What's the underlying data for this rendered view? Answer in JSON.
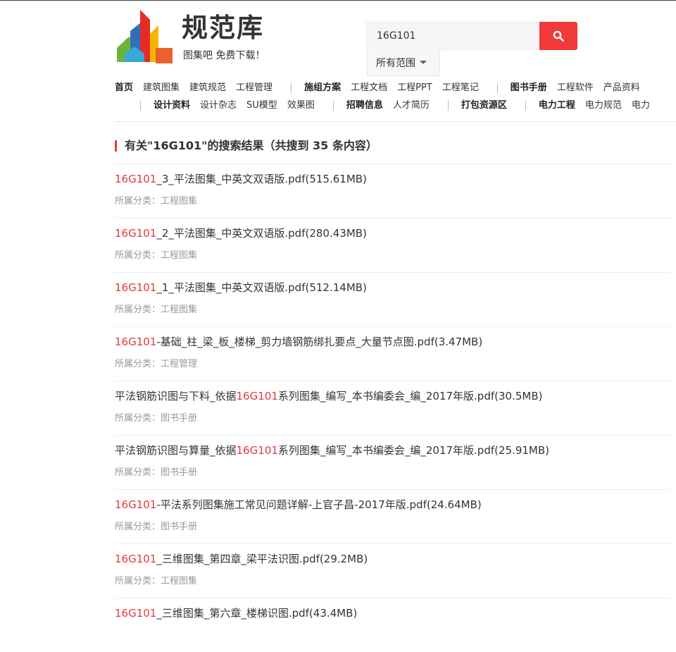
{
  "logo": {
    "name": "规范库",
    "tagline": "图集吧  免费下载！"
  },
  "search": {
    "query": "16G101",
    "scope_label": "所有范围"
  },
  "nav": {
    "row1": [
      {
        "label": "首页",
        "bold": true
      },
      {
        "label": "建筑图集"
      },
      {
        "label": "建筑规范"
      },
      {
        "label": "工程管理"
      },
      {
        "sep": true
      },
      {
        "label": "施组方案",
        "bold": true
      },
      {
        "label": "工程文档"
      },
      {
        "label": "工程PPT"
      },
      {
        "label": "工程笔记"
      },
      {
        "sep": true
      },
      {
        "label": "图书手册",
        "bold": true
      },
      {
        "label": "工程软件"
      },
      {
        "label": "产品资料"
      }
    ],
    "row2": [
      {
        "sep": true
      },
      {
        "label": "设计资料",
        "bold": true
      },
      {
        "label": "设计杂志"
      },
      {
        "label": "SU模型"
      },
      {
        "label": "效果图"
      },
      {
        "sep": true
      },
      {
        "label": "招聘信息",
        "bold": true
      },
      {
        "label": "人才简历"
      },
      {
        "sep": true
      },
      {
        "label": "打包资源区",
        "bold": true
      },
      {
        "sep": true
      },
      {
        "label": "电力工程",
        "bold": true
      },
      {
        "label": "电力规范"
      },
      {
        "label": "电力"
      }
    ]
  },
  "results_heading": "有关\"16G101\"的搜索结果（共搜到 35 条内容）",
  "category_prefix": "所属分类：",
  "results": [
    {
      "pre": "",
      "hl": "16G101",
      "post": "_3_平法图集_中英文双语版.pdf(515.61MB)",
      "category": "工程图集"
    },
    {
      "pre": "",
      "hl": "16G101",
      "post": "_2_平法图集_中英文双语版.pdf(280.43MB)",
      "category": "工程图集"
    },
    {
      "pre": "",
      "hl": "16G101",
      "post": "_1_平法图集_中英文双语版.pdf(512.14MB)",
      "category": "工程图集"
    },
    {
      "pre": "",
      "hl": "16G101",
      "post": "-基础_柱_梁_板_楼梯_剪力墙钢筋绑扎要点_大量节点图.pdf(3.47MB)",
      "category": "工程管理"
    },
    {
      "pre": "平法钢筋识图与下料_依据",
      "hl": "16G101",
      "post": "系列图集_编写_本书编委会_编_2017年版.pdf(30.5MB)",
      "category": "图书手册"
    },
    {
      "pre": "平法钢筋识图与算量_依据",
      "hl": "16G101",
      "post": "系列图集_编写_本书编委会_编_2017年版.pdf(25.91MB)",
      "category": "图书手册"
    },
    {
      "pre": "",
      "hl": "16G101",
      "post": "-平法系列图集施工常见问题详解-上官子昌-2017年版.pdf(24.64MB)",
      "category": "图书手册"
    },
    {
      "pre": "",
      "hl": "16G101",
      "post": "_三维图集_第四章_梁平法识图.pdf(29.2MB)",
      "category": "工程图集"
    },
    {
      "pre": "",
      "hl": "16G101",
      "post": "_三维图集_第六章_楼梯识图.pdf(43.4MB)",
      "category": ""
    }
  ]
}
